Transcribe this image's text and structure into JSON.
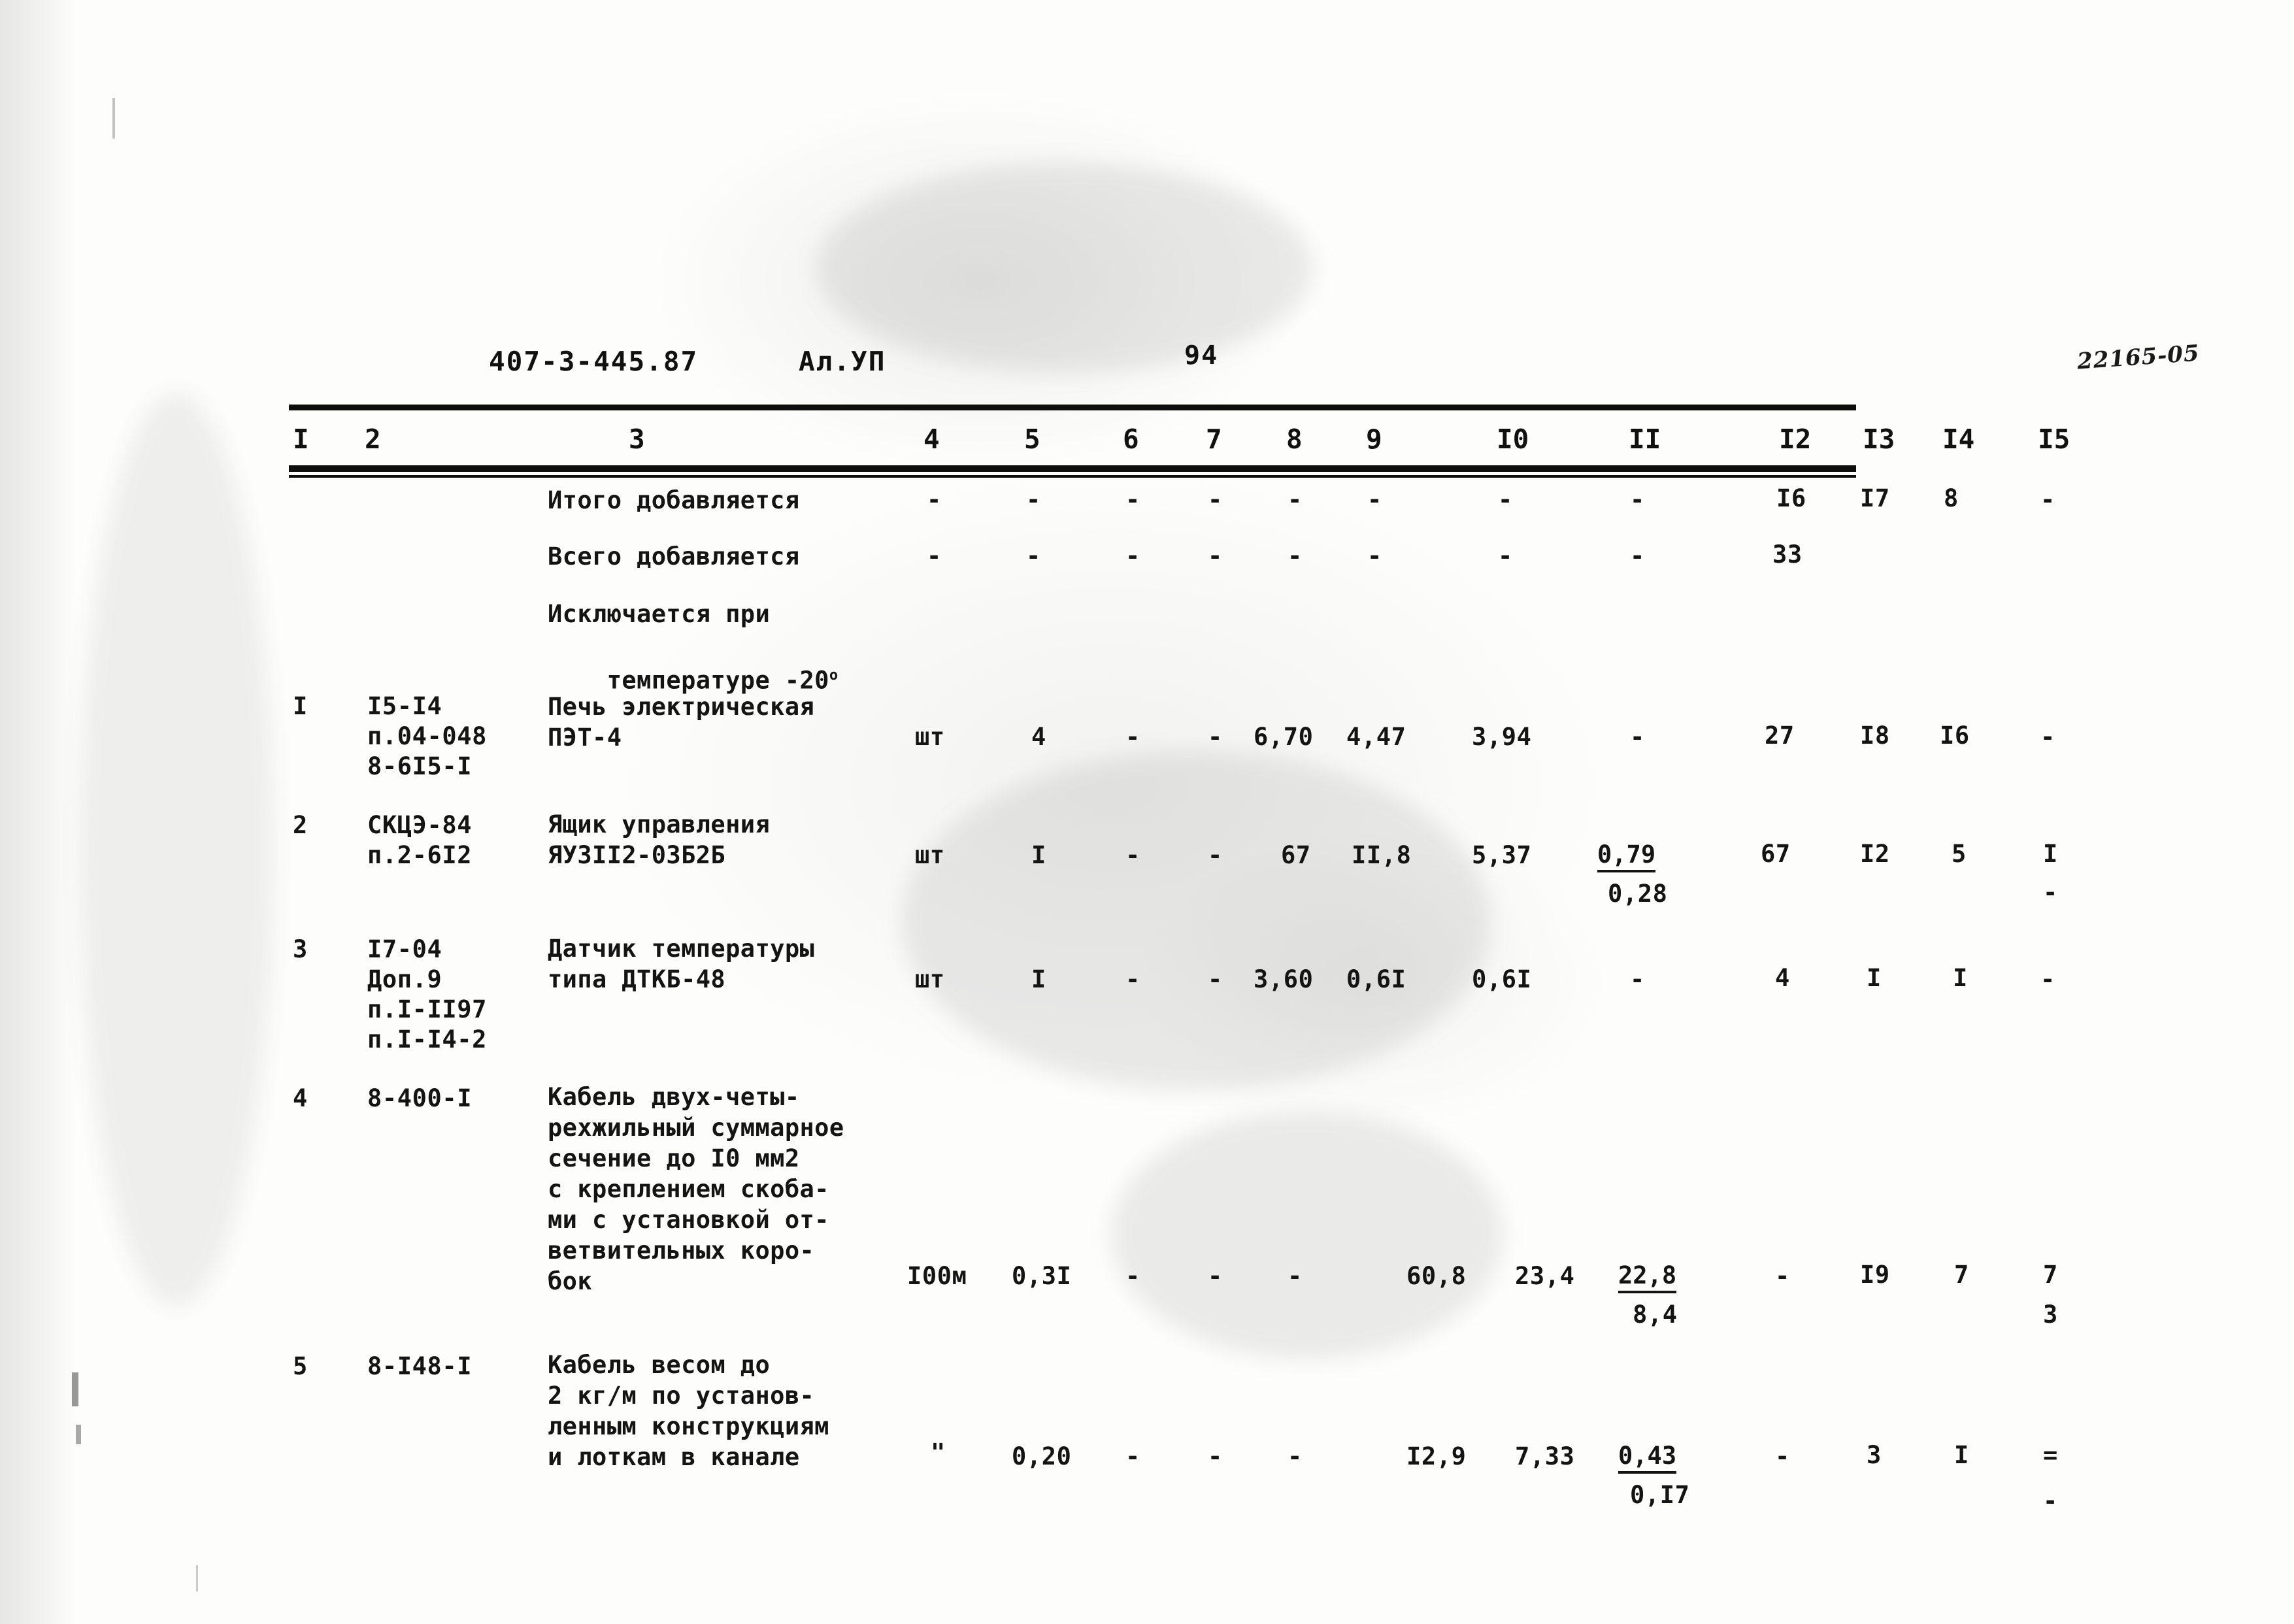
{
  "header": {
    "doc_code": "407-3-445.87",
    "album": "Ал.УП",
    "page_number": "94",
    "stamp": "22165-05"
  },
  "table": {
    "column_headers": [
      "I",
      "2",
      "3",
      "4",
      "5",
      "6",
      "7",
      "8",
      "9",
      "I0",
      "II",
      "I2",
      "I3",
      "I4",
      "I5"
    ],
    "summary_rows": [
      {
        "label": "Итого добавляется",
        "c4": "-",
        "c5": "-",
        "c6": "-",
        "c7": "-",
        "c8": "-",
        "c9": "-",
        "c10": "-",
        "c11": "-",
        "c12": "I6",
        "c13": "I7",
        "c14": "8",
        "c15": "-"
      },
      {
        "label": "Всего добавляется",
        "c4": "-",
        "c5": "-",
        "c6": "-",
        "c7": "-",
        "c8": "-",
        "c9": "-",
        "c10": "-",
        "c11": "-",
        "c12": "33",
        "c13": "",
        "c14": "",
        "c15": ""
      }
    ],
    "section_note": {
      "line1": "Исключается при",
      "line2": "температуре -20",
      "degree": "о"
    },
    "rows": [
      {
        "no": "I",
        "code_lines": [
          "I5-I4",
          "п.04-048",
          "8-6I5-I"
        ],
        "desc_lines": [
          "Печь электрическая",
          "ПЭТ-4"
        ],
        "unit": "шт",
        "c5": "4",
        "c6": "-",
        "c7": "-",
        "c8": "6,70",
        "c9": "4,47",
        "c10": "3,94",
        "c11": "-",
        "c11b": "",
        "c12": "27",
        "c13": "I8",
        "c14": "I6",
        "c15": "-",
        "c15b": ""
      },
      {
        "no": "2",
        "code_lines": [
          "СКЦЭ-84",
          "п.2-6I2"
        ],
        "desc_lines": [
          "Ящик управления",
          "ЯУ3II2-03Б2Б"
        ],
        "unit": "шт",
        "c5": "I",
        "c6": "-",
        "c7": "-",
        "c8": "67",
        "c9": "II,8",
        "c10": "5,37",
        "c11": "0,79",
        "c11b": "0,28",
        "c12": "67",
        "c13": "I2",
        "c14": "5",
        "c15": "I",
        "c15b": "-"
      },
      {
        "no": "3",
        "code_lines": [
          "I7-04",
          "Доп.9",
          "п.I-II97",
          "п.I-I4-2"
        ],
        "desc_lines": [
          "Датчик температуры",
          "типа ДТКБ-48"
        ],
        "unit": "шт",
        "c5": "I",
        "c6": "-",
        "c7": "-",
        "c8": "3,60",
        "c9": "0,6I",
        "c10": "0,6I",
        "c11": "-",
        "c11b": "",
        "c12": "4",
        "c13": "I",
        "c14": "I",
        "c15": "-",
        "c15b": ""
      },
      {
        "no": "4",
        "code_lines": [
          "8-400-I"
        ],
        "desc_lines": [
          "Кабель двух-четы-",
          "рехжильный суммарное",
          "сечение до I0 мм2",
          "с креплением скоба-",
          "ми с установкой от-",
          "ветвительных коро-",
          "бок"
        ],
        "unit": "I00м",
        "c5": "0,3I",
        "c6": "-",
        "c7": "-",
        "c8": "-",
        "c9": "60,8",
        "c10": "23,4",
        "c11": "22,8",
        "c11b": "8,4",
        "c12": "-",
        "c13": "I9",
        "c14": "7",
        "c15": "7",
        "c15b": "3"
      },
      {
        "no": "5",
        "code_lines": [
          "8-I48-I"
        ],
        "desc_lines": [
          "Кабель весом до",
          "2 кг/м по установ-",
          "ленным конструкциям",
          "и лоткам в канале"
        ],
        "unit": "\"",
        "c5": "0,20",
        "c6": "-",
        "c7": "-",
        "c8": "-",
        "c9": "I2,9",
        "c10": "7,33",
        "c11": "0,43",
        "c11b": "0,I7",
        "c12": "-",
        "c13": "3",
        "c14": "I",
        "c15": "=",
        "c15b": "-"
      }
    ]
  }
}
